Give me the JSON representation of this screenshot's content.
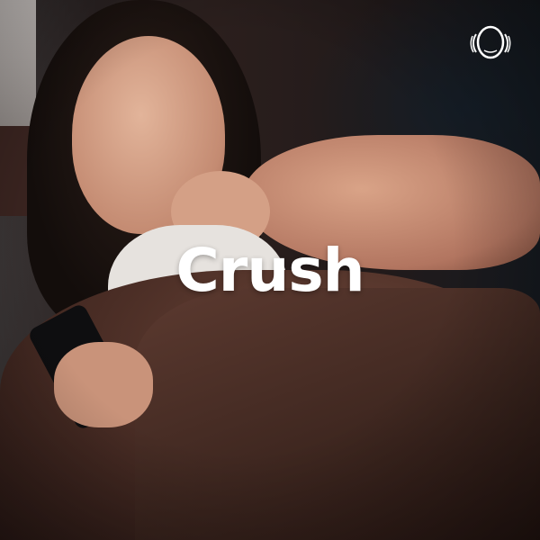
{
  "cover": {
    "title": "Crush",
    "logo_icon": "headphone-face-logo-icon",
    "colors": {
      "title": "#ffffff",
      "background": "#1a1414",
      "blanket": "#4a2d25"
    }
  }
}
